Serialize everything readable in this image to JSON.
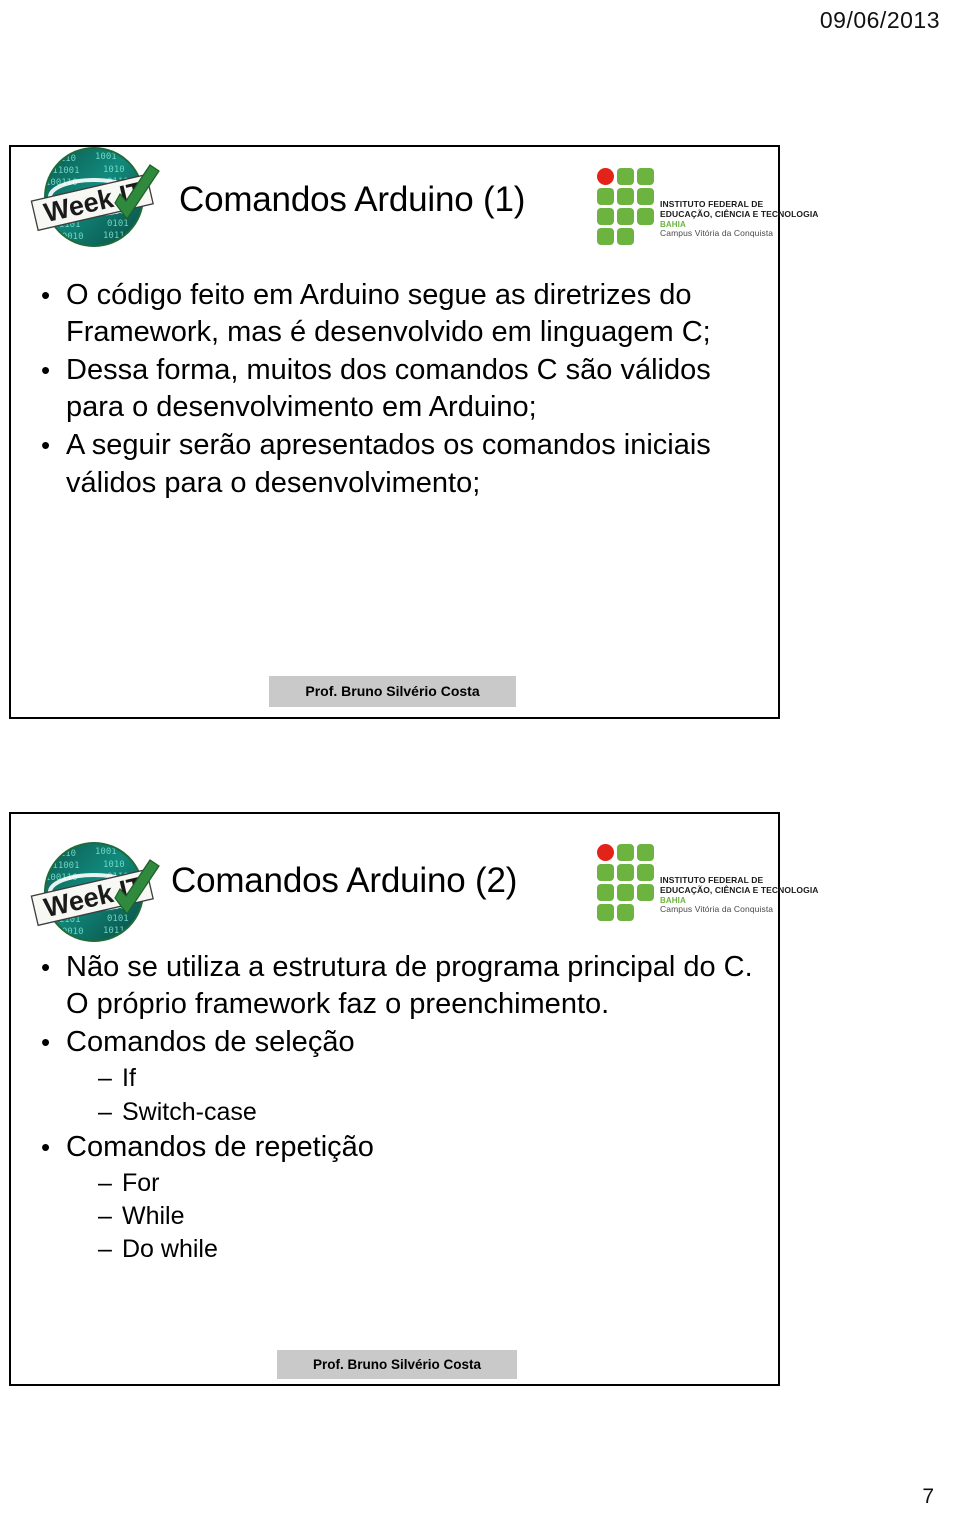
{
  "page": {
    "date": "09/06/2013",
    "page_number": "7"
  },
  "logos": {
    "weekit": {
      "name": "week-it-logo",
      "word1": "Week",
      "word2": "IT",
      "icon": "check-mark-icon",
      "binary_texture": "101001100101"
    },
    "ifba": {
      "name": "ifba-logo",
      "line1": "INSTITUTO FEDERAL DE",
      "line2": "EDUCAÇÃO, CIÊNCIA E TECNOLOGIA",
      "line3": "BAHIA",
      "line4": "Campus Vitória da Conquista",
      "green": "#6cb33f",
      "red": "#e2231a"
    }
  },
  "slides": [
    {
      "id": "slide-1",
      "title": "Comandos Arduino (1)",
      "bullets": [
        {
          "level": 1,
          "mark": "•",
          "text": "O código feito em Arduino segue as diretrizes do Framework, mas é desenvolvido em linguagem C;"
        },
        {
          "level": 1,
          "mark": "•",
          "text": "Dessa forma, muitos dos comandos C são válidos para o desenvolvimento em Arduino;"
        },
        {
          "level": 1,
          "mark": "•",
          "text": "A seguir serão apresentados os comandos iniciais válidos para o desenvolvimento;"
        }
      ],
      "presenter": "Prof. Bruno Silvério Costa"
    },
    {
      "id": "slide-2",
      "title": "Comandos Arduino (2)",
      "bullets": [
        {
          "level": 1,
          "mark": "•",
          "text": "Não se utiliza a estrutura de programa principal do C. O próprio framework faz o preenchimento."
        },
        {
          "level": 1,
          "mark": "•",
          "text": "Comandos de seleção"
        },
        {
          "level": 2,
          "mark": "–",
          "text": "If"
        },
        {
          "level": 2,
          "mark": "–",
          "text": "Switch-case"
        },
        {
          "level": 1,
          "mark": "•",
          "text": "Comandos de repetição"
        },
        {
          "level": 2,
          "mark": "–",
          "text": "For"
        },
        {
          "level": 2,
          "mark": "–",
          "text": "While"
        },
        {
          "level": 2,
          "mark": "–",
          "text": "Do while"
        }
      ],
      "presenter": "Prof. Bruno Silvério Costa"
    }
  ]
}
